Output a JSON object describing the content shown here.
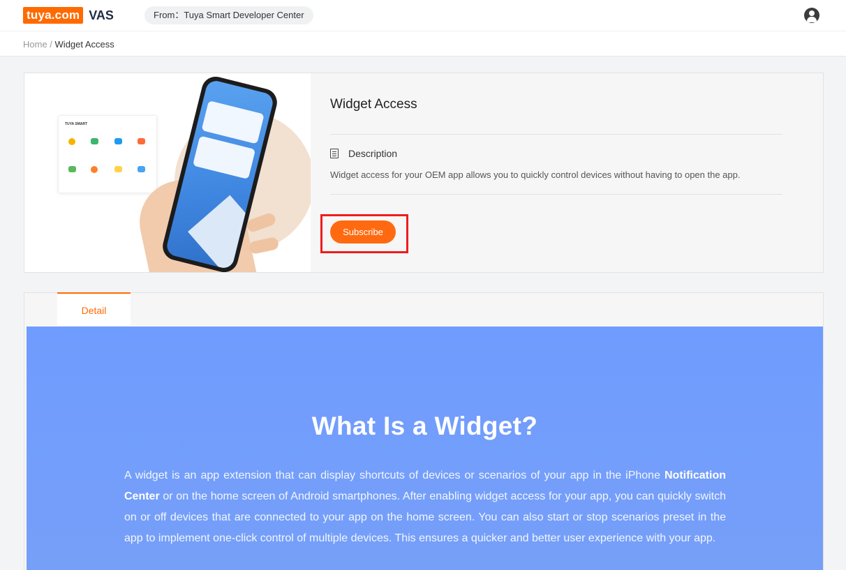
{
  "header": {
    "logo_text": "tuya.com",
    "logo_suffix": "VAS",
    "from_label": "From：Tuya Smart Developer Center"
  },
  "breadcrumb": {
    "home": "Home",
    "separator": " / ",
    "current": "Widget Access"
  },
  "product": {
    "title": "Widget Access",
    "description_heading": "Description",
    "description": "Widget access for your OEM app allows you to quickly control devices without having to open the app.",
    "subscribe_label": "Subscribe",
    "hero_panel_title": "TUYA SMART"
  },
  "tabs": [
    {
      "label": "Detail",
      "active": true
    }
  ],
  "banner": {
    "title": "What Is a Widget?",
    "text_before_bold": "A widget is an app extension that can display shortcuts of devices or scenarios of your app in the iPhone ",
    "text_bold": "Notification Center",
    "text_after_bold": " or on the home screen of Android smartphones. After enabling widget access for your app, you can quickly switch on or off devices that are connected to your app on the home screen. You can also start or stop scenarios preset in the app to implement one-click control of multiple devices. This ensures a quicker and better user experience with your app."
  },
  "colors": {
    "brand_orange": "#ff6a00",
    "highlight_red": "#ef1c1c",
    "banner_blue": "#6f9cff"
  },
  "icons": {
    "avatar": "user-avatar-icon",
    "description": "document-icon"
  }
}
